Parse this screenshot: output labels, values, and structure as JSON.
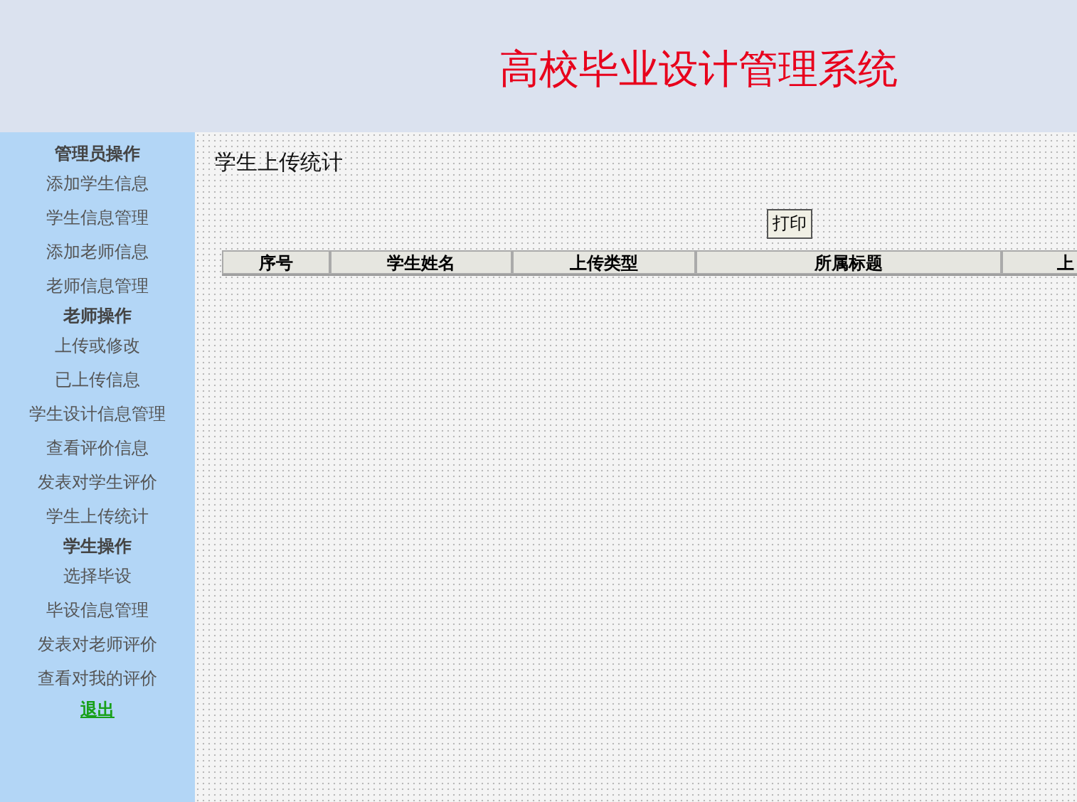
{
  "header": {
    "title": "高校毕业设计管理系统"
  },
  "sidebar": {
    "groups": [
      {
        "title": "管理员操作",
        "items": [
          "添加学生信息",
          "学生信息管理",
          "添加老师信息",
          "老师信息管理"
        ]
      },
      {
        "title": "老师操作",
        "items": [
          "上传或修改",
          "已上传信息",
          "学生设计信息管理",
          "查看评价信息",
          "发表对学生评价",
          "学生上传统计"
        ]
      },
      {
        "title": "学生操作",
        "items": [
          "选择毕设",
          "毕设信息管理",
          "发表对老师评价",
          "查看对我的评价"
        ]
      }
    ],
    "exit": "退出"
  },
  "main": {
    "title": "学生上传统计",
    "print_button": "打印",
    "table": {
      "columns": [
        "序号",
        "学生姓名",
        "上传类型",
        "所属标题",
        "上"
      ]
    }
  }
}
